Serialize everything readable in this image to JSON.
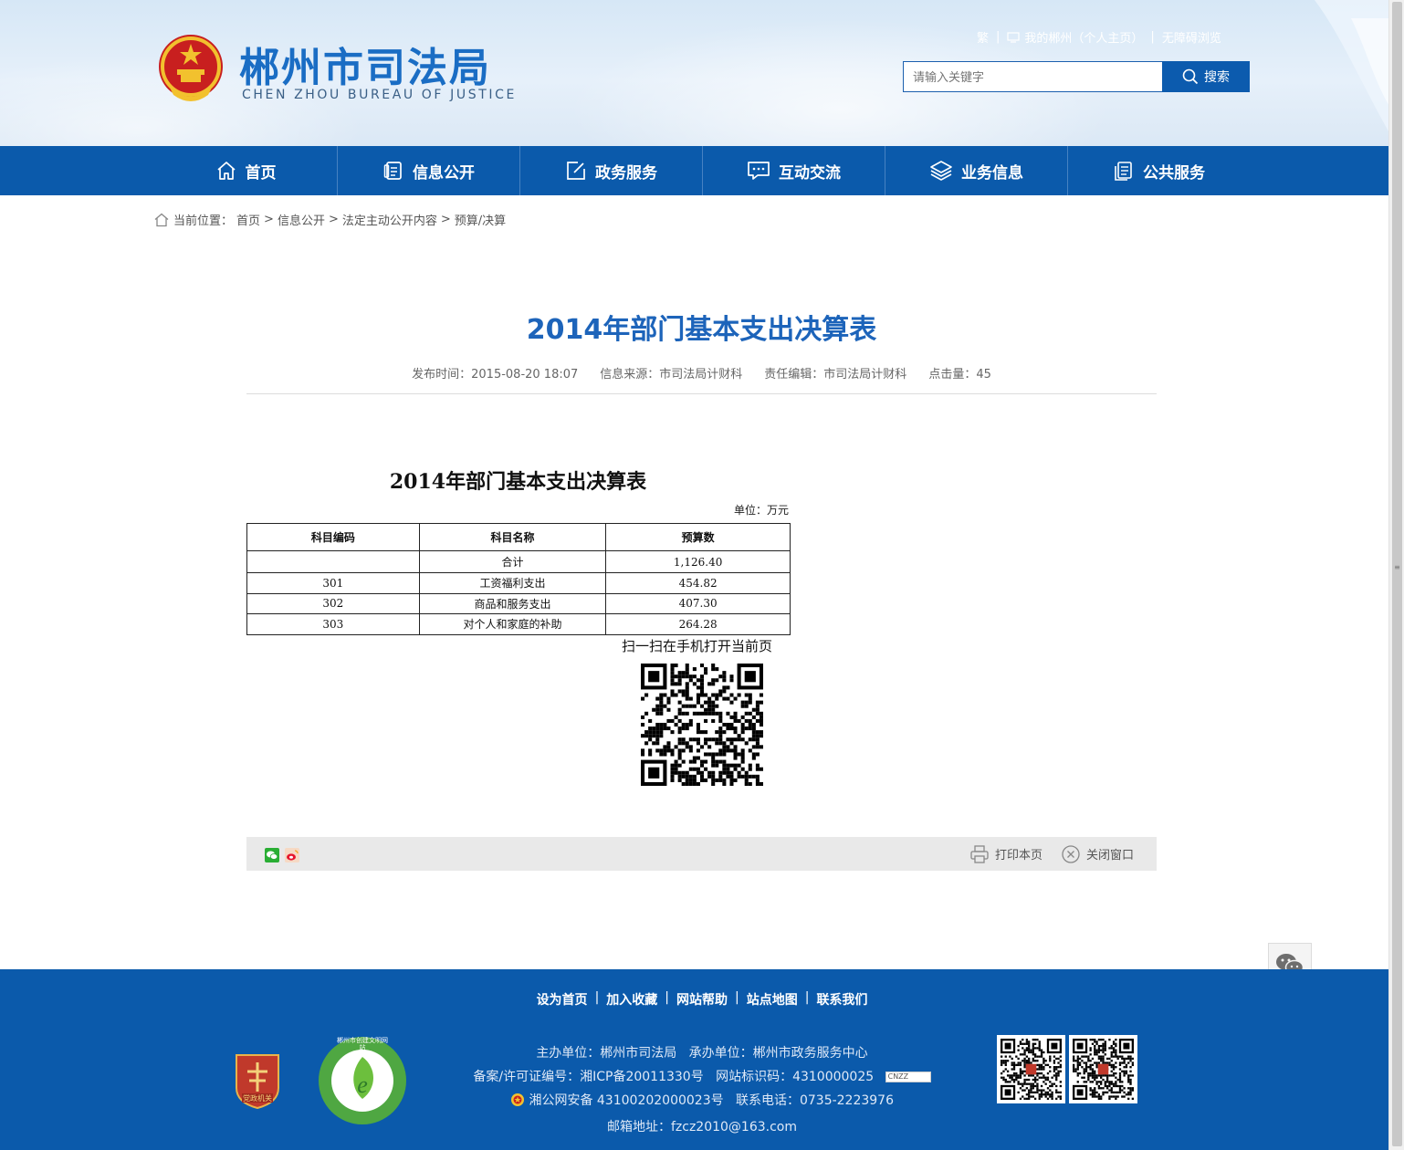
{
  "header": {
    "title": "郴州市司法局",
    "subtitle": "CHEN ZHOU BUREAU OF JUSTICE",
    "links": {
      "traditional": "繁",
      "my_chenzhou": "我的郴州（个人主页）",
      "accessibility": "无障碍浏览"
    },
    "search": {
      "placeholder": "请输入关键字",
      "button_label": "搜索"
    }
  },
  "nav": {
    "items": [
      {
        "label": "首页",
        "icon": "home-icon"
      },
      {
        "label": "信息公开",
        "icon": "document-icon"
      },
      {
        "label": "政务服务",
        "icon": "edit-icon"
      },
      {
        "label": "互动交流",
        "icon": "chat-icon"
      },
      {
        "label": "业务信息",
        "icon": "layers-icon"
      },
      {
        "label": "公共服务",
        "icon": "files-icon"
      }
    ]
  },
  "breadcrumb": {
    "prefix": "当前位置：",
    "items": [
      "首页",
      "信息公开",
      "法定主动公开内容",
      "预算/决算"
    ],
    "separator": ">"
  },
  "article": {
    "title": "2014年部门基本支出决算表",
    "meta": {
      "publish_time": "发布时间：2015-08-20 18:07",
      "source": "信息来源：市司法局计财科",
      "editor": "责任编辑：市司法局计财科",
      "views": "点击量：45"
    },
    "doc_title": "2014年部门基本支出决算表",
    "unit": "单位：万元",
    "table": {
      "headers": [
        "科目编码",
        "科目名称",
        "预算数"
      ],
      "rows": [
        [
          "",
          "合计",
          "1,126.40"
        ],
        [
          "301",
          "工资福利支出",
          "454.82"
        ],
        [
          "302",
          "商品和服务支出",
          "407.30"
        ],
        [
          "303",
          "对个人和家庭的补助",
          "264.28"
        ]
      ]
    },
    "qr_caption": "扫一扫在手机打开当前页",
    "actions": {
      "print": "打印本页",
      "close": "关闭窗口"
    }
  },
  "footer": {
    "links": [
      "设为首页",
      "加入收藏",
      "网站帮助",
      "站点地图",
      "联系我们"
    ],
    "sponsor": "主办单位：郴州市司法局",
    "organizer": "承办单位：郴州市政务服务中心",
    "icp": "备案/许可证编号：湘ICP备20011330号",
    "site_code": "网站标识码：4310000025",
    "police": "湘公网安备 43100202000023号",
    "phone": "联系电话：0735-2223976",
    "email": "邮箱地址：fzcz2010@163.com",
    "badge_gov_label": "党政机关",
    "badge_green_label": "郴州市创建文明网站",
    "cnzz_label": "CNZZ"
  },
  "colors": {
    "brand_blue": "#0b5aab",
    "title_blue": "#1d64ba"
  }
}
